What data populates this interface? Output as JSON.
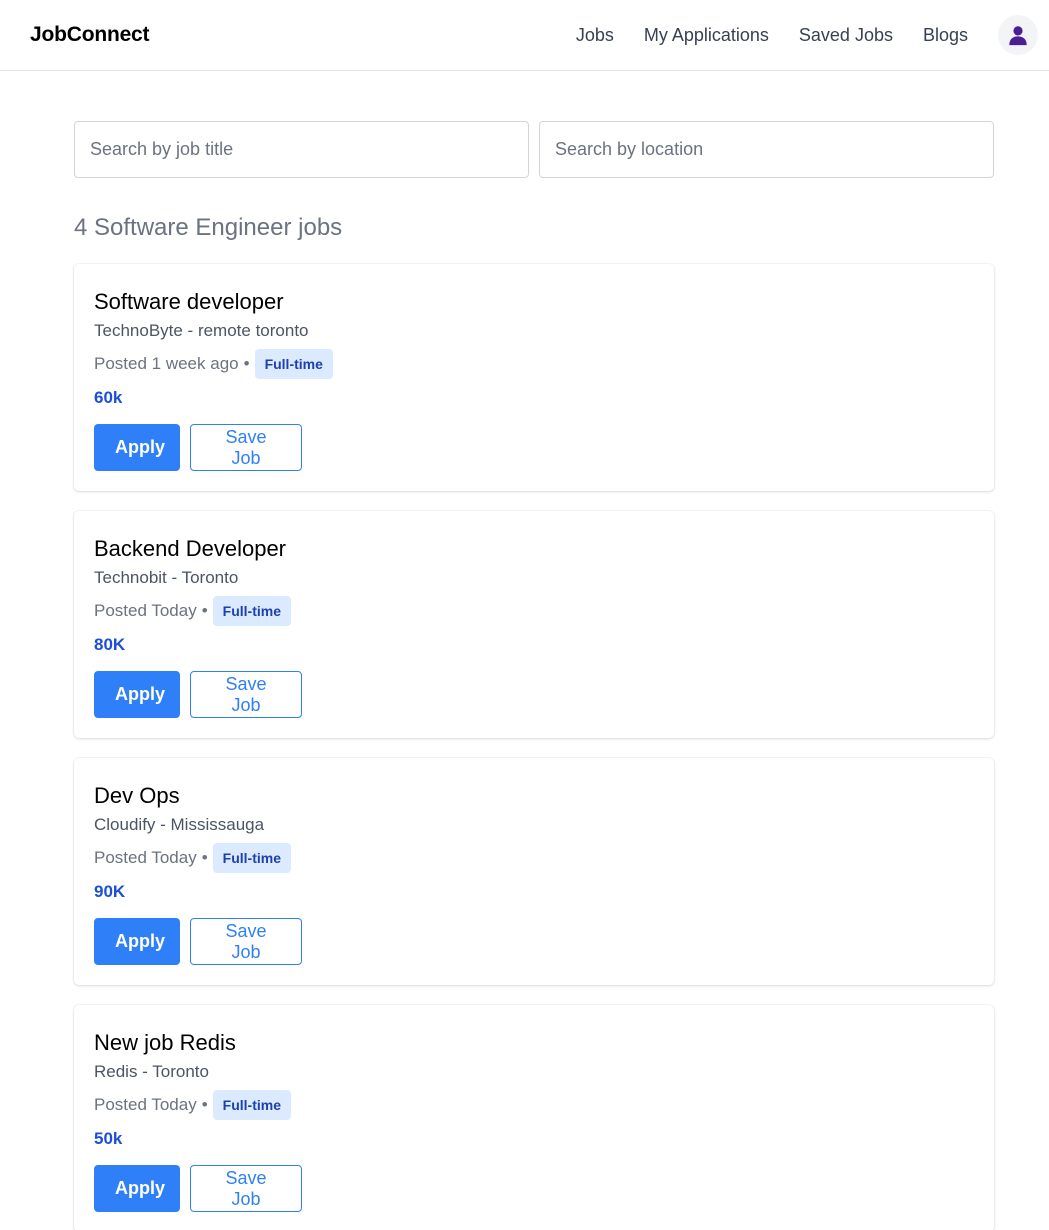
{
  "nav": {
    "brand": "JobConnect",
    "links": [
      "Jobs",
      "My Applications",
      "Saved Jobs",
      "Blogs"
    ],
    "avatar_icon": "user-icon",
    "avatar_color": "#4c1d95"
  },
  "search": {
    "title_placeholder": "Search by job title",
    "location_placeholder": "Search by location"
  },
  "results": {
    "heading": "4 Software Engineer jobs"
  },
  "jobs": [
    {
      "title": "Software developer",
      "company_location": "TechnoByte - remote toronto",
      "posted": "Posted 1 week ago",
      "separator": "•",
      "type": "Full-time",
      "salary": "60k",
      "apply_label": "Apply",
      "save_label": "Save Job"
    },
    {
      "title": "Backend Developer",
      "company_location": "Technobit - Toronto",
      "posted": "Posted Today",
      "separator": "•",
      "type": "Full-time",
      "salary": "80K",
      "apply_label": "Apply",
      "save_label": "Save Job"
    },
    {
      "title": "Dev Ops",
      "company_location": "Cloudify - Mississauga",
      "posted": "Posted Today",
      "separator": "•",
      "type": "Full-time",
      "salary": "90K",
      "apply_label": "Apply",
      "save_label": "Save Job"
    },
    {
      "title": "New job Redis",
      "company_location": "Redis - Toronto",
      "posted": "Posted Today",
      "separator": "•",
      "type": "Full-time",
      "salary": "50k",
      "apply_label": "Apply",
      "save_label": "Save Job"
    }
  ],
  "colors": {
    "accent": "#2f80f8",
    "badge_bg": "#dbeafe",
    "badge_text": "#1e40af",
    "salary": "#1d4ed8"
  }
}
